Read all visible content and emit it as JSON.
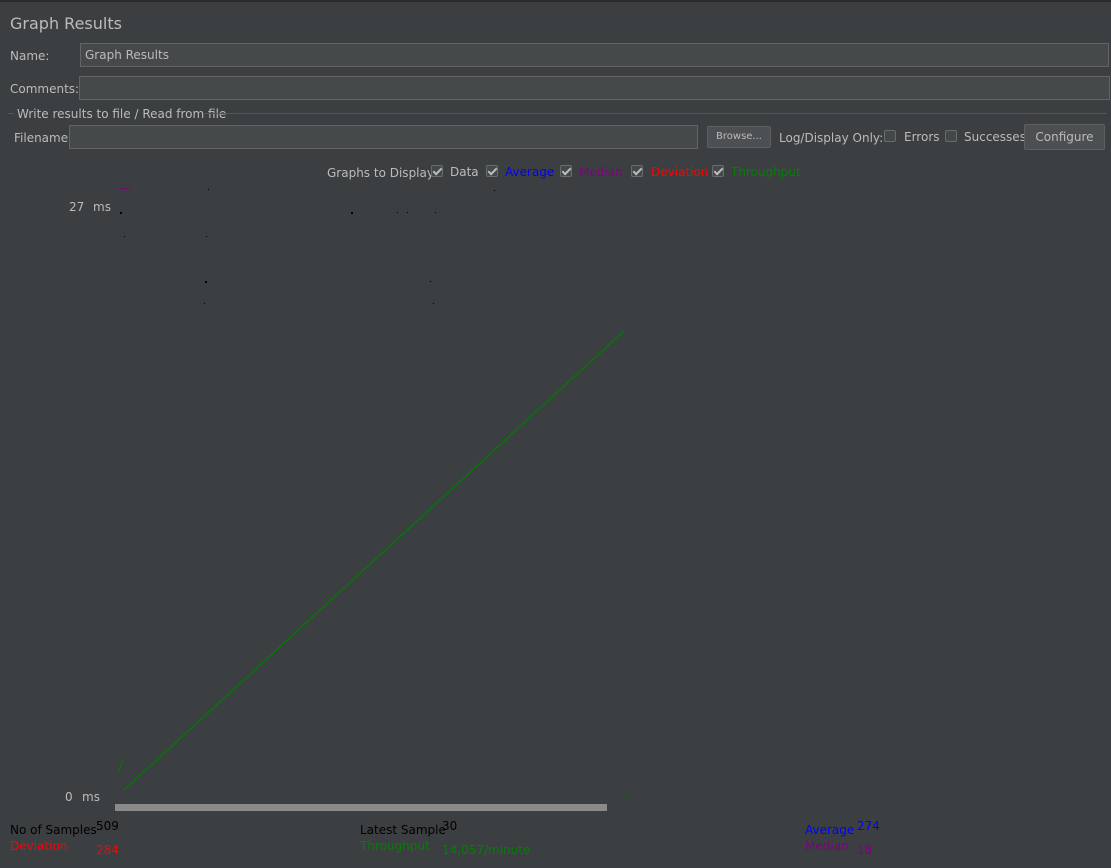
{
  "panel": {
    "title": "Graph Results"
  },
  "form": {
    "name_label": "Name:",
    "name_value": "Graph Results",
    "comments_label": "Comments:",
    "comments_value": "",
    "file_group_label": "Write results to file / Read from file",
    "filename_label": "Filename",
    "filename_value": "",
    "browse_label": "Browse...",
    "log_display_label": "Log/Display Only:",
    "errors_label": "Errors",
    "errors_checked": false,
    "successes_label": "Successes",
    "successes_checked": false,
    "configure_label": "Configure"
  },
  "graphs_to_display": {
    "label": "Graphs to Display",
    "options": [
      {
        "label": "Data",
        "checked": true,
        "color": "#bbbbbb"
      },
      {
        "label": "Average",
        "checked": true,
        "color": "#0000ff"
      },
      {
        "label": "Median",
        "checked": true,
        "color": "#800080"
      },
      {
        "label": "Deviation",
        "checked": true,
        "color": "#ff0000"
      },
      {
        "label": "Throughput",
        "checked": true,
        "color": "#008000"
      }
    ]
  },
  "graph": {
    "y_max_value": "27",
    "y_max_unit": "ms",
    "y_min_value": "0",
    "y_min_unit": "ms",
    "throughput_color": "#007a00"
  },
  "stats": {
    "samples_label": "No of Samples",
    "samples_value": "509",
    "deviation_label": "Deviation",
    "deviation_value": "284",
    "latest_label": "Latest Sample",
    "latest_value": "30",
    "throughput_label": "Throughput",
    "throughput_value": "14,057/minute",
    "average_label": "Average",
    "average_value": "274",
    "median_label": "Median",
    "median_value": "18",
    "colors": {
      "black": "#000000",
      "red": "#ff0000",
      "green": "#008000",
      "blue": "#0000ff",
      "purple": "#800080"
    }
  }
}
